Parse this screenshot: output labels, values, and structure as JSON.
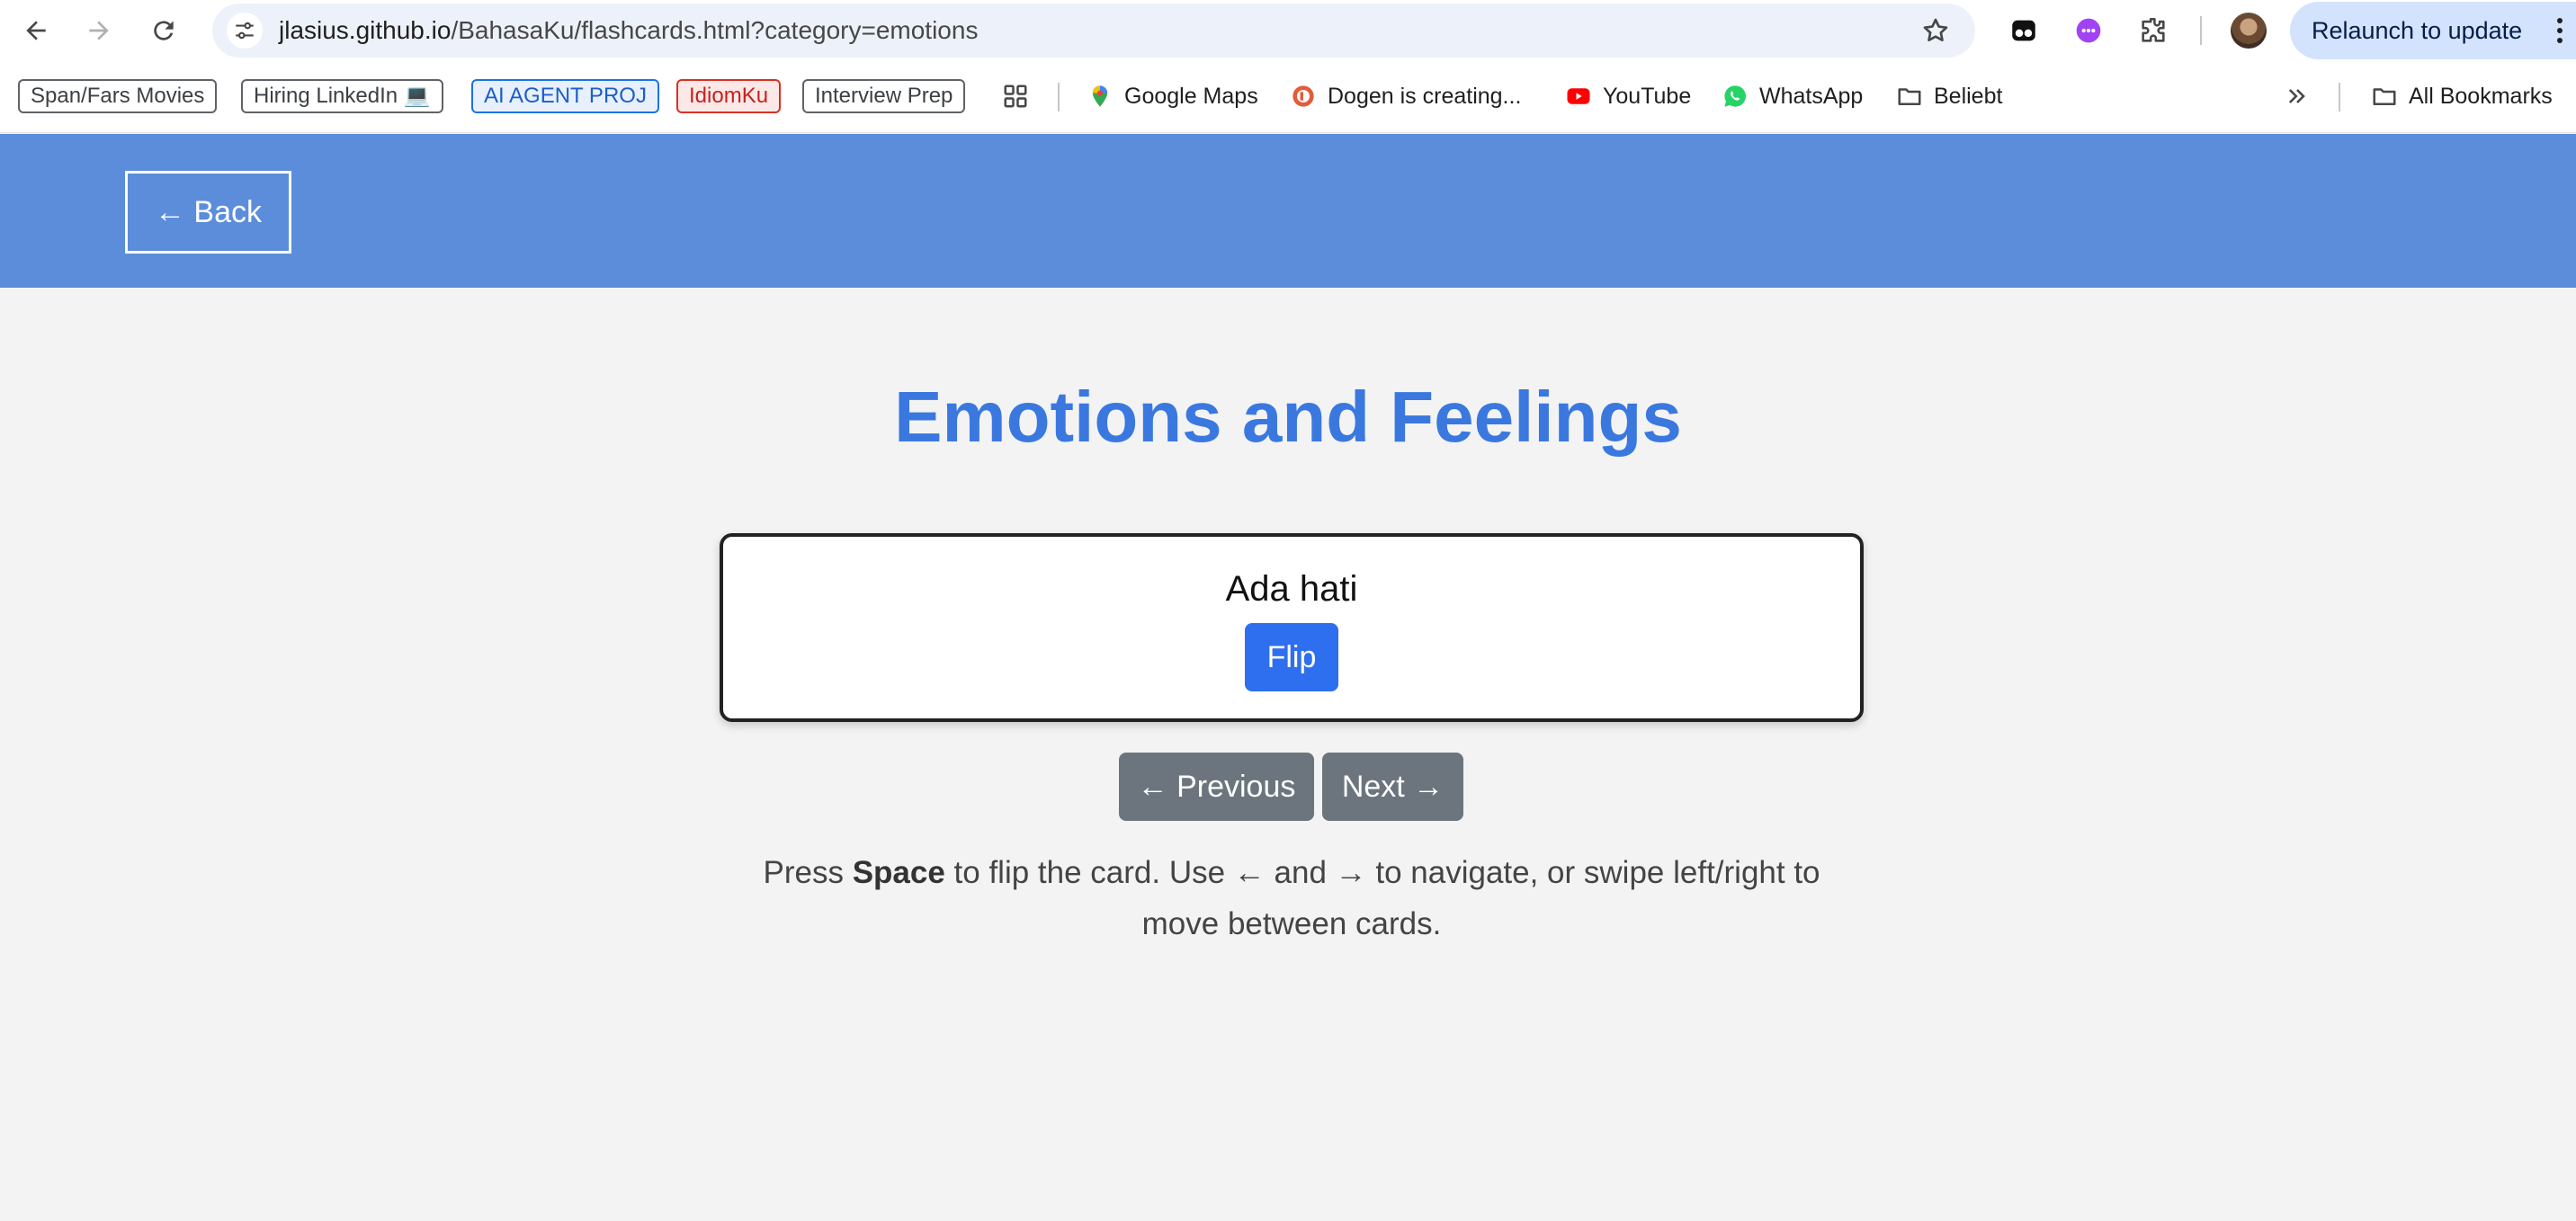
{
  "browser": {
    "url_host": "jlasius.github.io",
    "url_path": "/BahasaKu/flashcards.html?category=emotions",
    "relaunch_label": "Relaunch to update"
  },
  "bookmarks": {
    "chips": [
      "Span/Fars Movies",
      "Hiring LinkedIn 💻",
      "AI AGENT PROJ",
      "IdiomKu",
      "Interview Prep"
    ],
    "items": [
      "Google Maps",
      "Dogen is creating...",
      "YouTube",
      "WhatsApp",
      "Beliebt"
    ],
    "all_bookmarks": "All Bookmarks"
  },
  "page": {
    "back_label": "← Back",
    "title": "Emotions and Feelings",
    "card_word": "Ada hati",
    "flip_label": "Flip",
    "previous_label": "← Previous",
    "next_label": "Next →",
    "help": {
      "part1": "Press ",
      "key": "Space",
      "part2": " to flip the card. Use ← and → to navigate, or swipe left/right to move between cards."
    }
  },
  "colors": {
    "header_bg": "#5b8ddb",
    "title": "#3a78e0",
    "flip_button": "#2e6fef",
    "nav_button": "#6c757d",
    "page_bg": "#f3f3f3"
  },
  "icons": [
    "back-arrow-icon",
    "forward-arrow-icon",
    "reload-icon",
    "site-info-icon",
    "star-icon",
    "extensions-icon",
    "apps-grid-icon",
    "google-maps-icon",
    "youtube-icon",
    "whatsapp-icon",
    "folder-icon",
    "chevron-double-right-icon",
    "kebab-menu-icon"
  ]
}
